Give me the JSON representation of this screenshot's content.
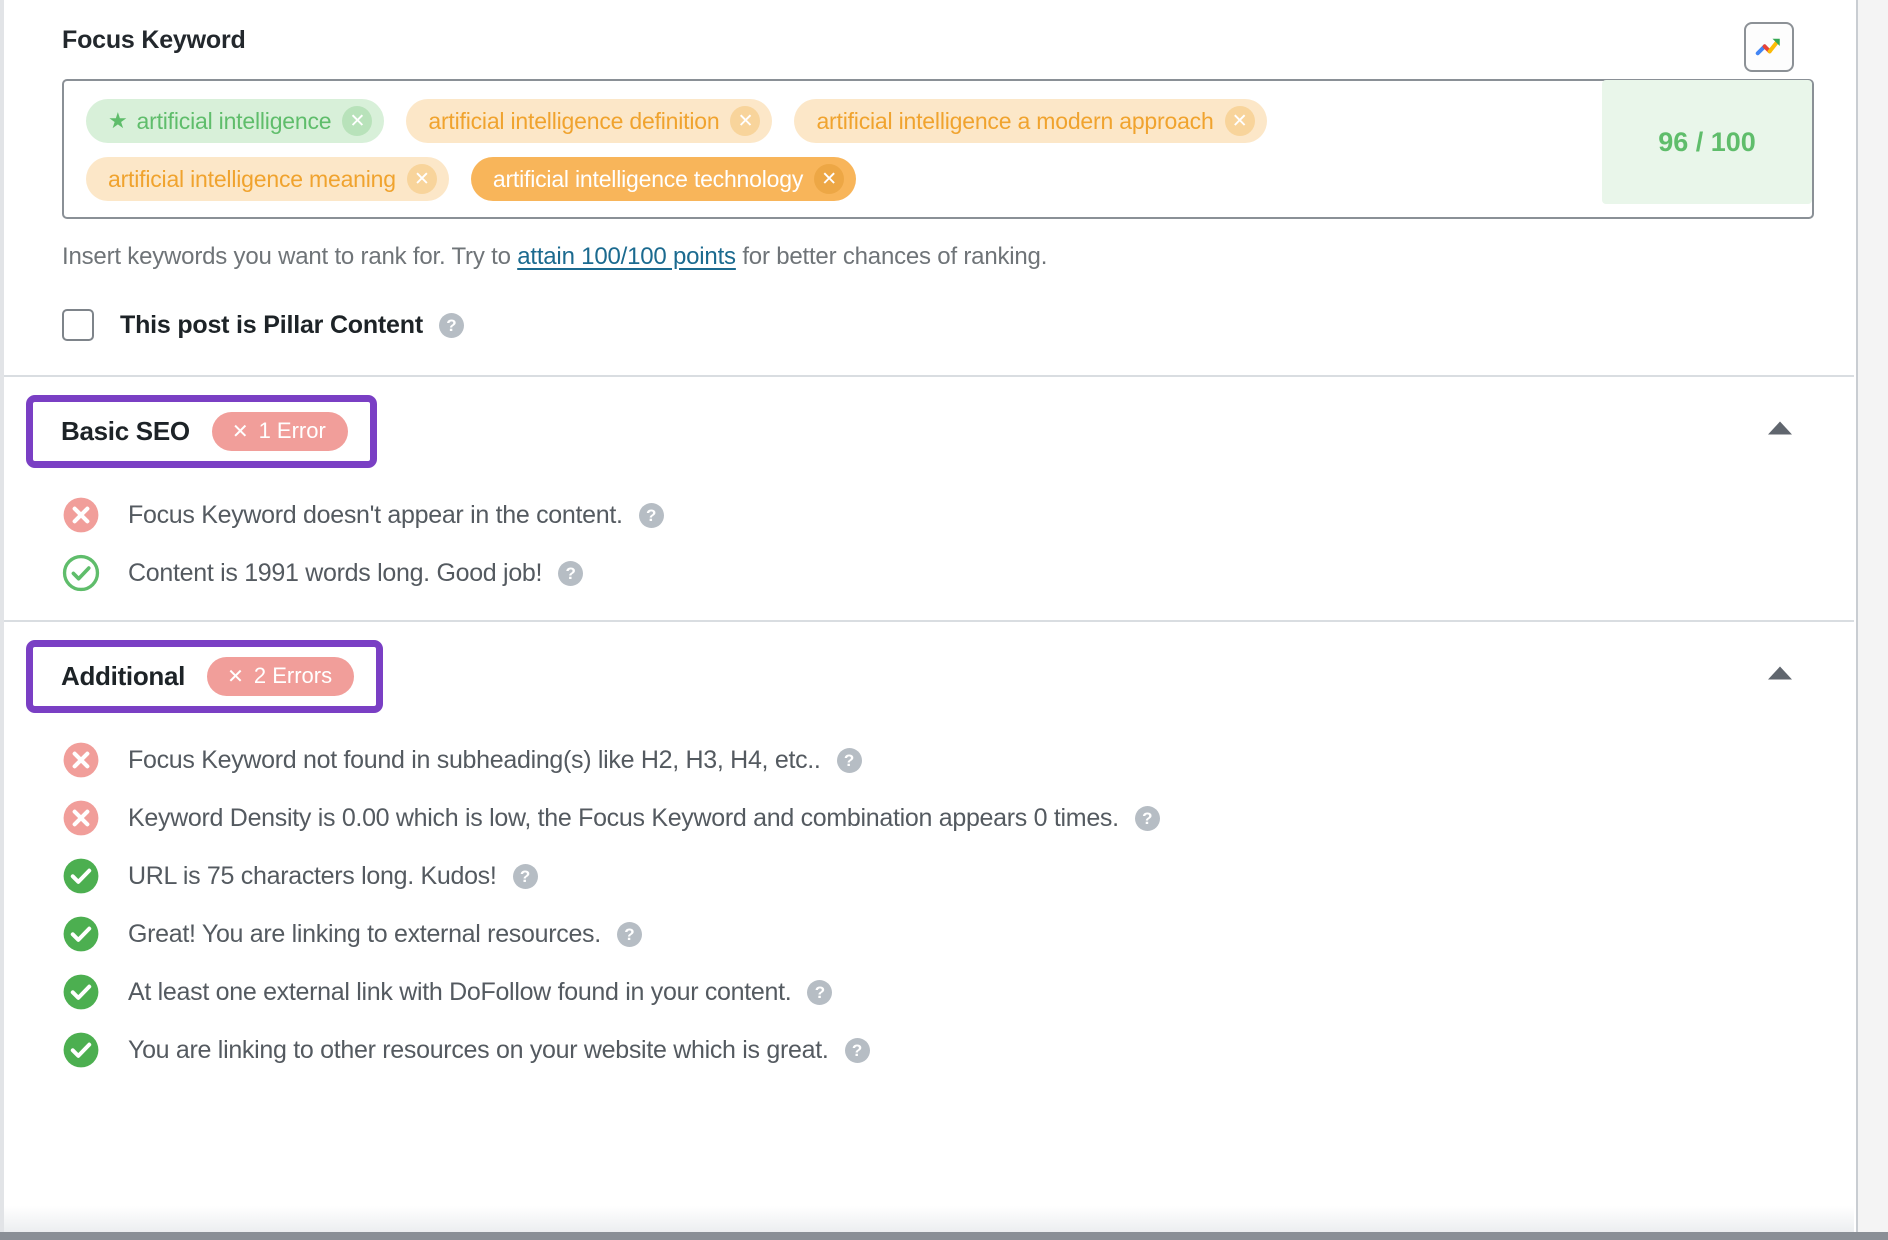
{
  "focus_keyword": {
    "title": "Focus Keyword",
    "trends_icon": "google-trends-icon",
    "score": "96 / 100",
    "keywords": [
      {
        "label": "artificial intelligence",
        "style": "primary",
        "starred": true,
        "star": "★",
        "remove": "✕"
      },
      {
        "label": "artificial intelligence definition",
        "style": "light",
        "starred": false,
        "remove": "✕"
      },
      {
        "label": "artificial intelligence a modern approach",
        "style": "light",
        "starred": false,
        "remove": "✕"
      },
      {
        "label": "artificial intelligence meaning",
        "style": "light",
        "starred": false,
        "remove": "✕"
      },
      {
        "label": "artificial intelligence technology",
        "style": "solid",
        "starred": false,
        "remove": "✕"
      }
    ],
    "help_prefix": "Insert keywords you want to rank for. Try to ",
    "help_link": "attain 100/100 points",
    "help_suffix": " for better chances of ranking.",
    "pillar_label": "This post is Pillar Content",
    "pillar_checked": false,
    "help_glyph": "?"
  },
  "sections": [
    {
      "title": "Basic SEO",
      "error_badge": "1 Error",
      "badge_x": "✕",
      "collapsed": false,
      "caret": "caret-up-icon",
      "items": [
        {
          "status": "error",
          "text": "Focus Keyword doesn't appear in the content.",
          "help": "?"
        },
        {
          "status": "ok-outline",
          "text": "Content is 1991 words long. Good job!",
          "help": "?"
        }
      ]
    },
    {
      "title": "Additional",
      "error_badge": "2 Errors",
      "badge_x": "✕",
      "collapsed": false,
      "caret": "caret-up-icon",
      "items": [
        {
          "status": "error",
          "text": "Focus Keyword not found in subheading(s) like H2, H3, H4, etc..",
          "help": "?"
        },
        {
          "status": "error",
          "text": "Keyword Density is 0.00 which is low, the Focus Keyword and combination appears 0 times.",
          "help": "?"
        },
        {
          "status": "ok",
          "text": "URL is 75 characters long. Kudos!",
          "help": "?"
        },
        {
          "status": "ok",
          "text": "Great! You are linking to external resources.",
          "help": "?"
        },
        {
          "status": "ok",
          "text": "At least one external link with DoFollow found in your content.",
          "help": "?"
        },
        {
          "status": "ok",
          "text": "You are linking to other resources on your website which is great.",
          "help": "?"
        }
      ]
    }
  ],
  "colors": {
    "annotation_purple": "#7a3fc4",
    "error_red": "#f19e9a",
    "success_green": "#5fbd6b",
    "keyword_orange": "#f0a32e",
    "link_blue": "#1b6a8f",
    "score_bg": "#e9f6ea"
  }
}
